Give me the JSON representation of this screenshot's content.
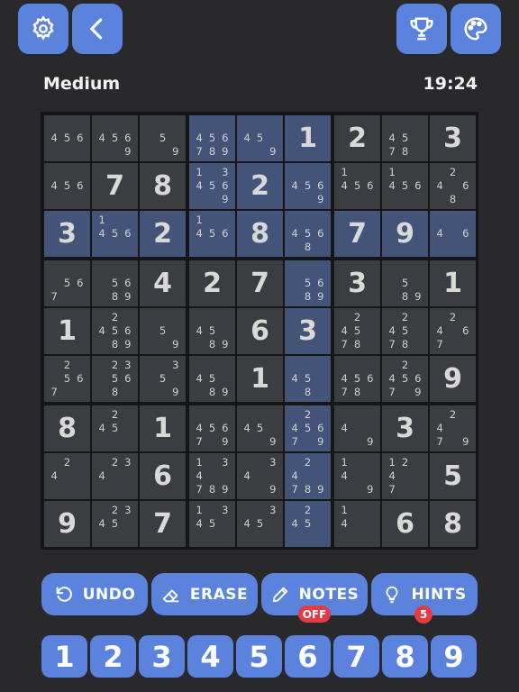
{
  "header": {
    "settings_icon": "gear-icon",
    "back_icon": "chevron-left-icon",
    "trophy_icon": "trophy-icon",
    "palette_icon": "palette-icon",
    "difficulty": "Medium",
    "timer": "19:24"
  },
  "board": {
    "selected": [
      2,
      5
    ],
    "cells": [
      [
        {
          "n": [
            4,
            5,
            6
          ]
        },
        {
          "n": [
            4,
            5,
            6,
            9
          ]
        },
        {
          "n": [
            5,
            9
          ]
        },
        {
          "n": [
            4,
            5,
            6,
            7,
            8,
            9
          ]
        },
        {
          "n": [
            4,
            5,
            9
          ]
        },
        {
          "v": "1"
        },
        {
          "v": "2"
        },
        {
          "n": [
            4,
            5,
            7,
            8
          ]
        },
        {
          "v": "3"
        }
      ],
      [
        {
          "n": [
            4,
            5,
            6
          ]
        },
        {
          "v": "7"
        },
        {
          "v": "8"
        },
        {
          "n": [
            1,
            3,
            4,
            5,
            6,
            9
          ]
        },
        {
          "v": "2"
        },
        {
          "n": [
            4,
            5,
            6,
            9
          ]
        },
        {
          "n": [
            1,
            4,
            5,
            6
          ]
        },
        {
          "n": [
            1,
            4,
            5,
            6
          ]
        },
        {
          "n": [
            2,
            4,
            6,
            8
          ]
        }
      ],
      [
        {
          "v": "3"
        },
        {
          "n": [
            1,
            4,
            5,
            6
          ]
        },
        {
          "v": "2"
        },
        {
          "n": [
            1,
            4,
            5,
            6
          ]
        },
        {
          "v": "8"
        },
        {
          "n": [
            4,
            5,
            6,
            8
          ]
        },
        {
          "v": "7"
        },
        {
          "v": "9"
        },
        {
          "n": [
            4,
            6
          ]
        }
      ],
      [
        {
          "n": [
            5,
            6,
            7
          ]
        },
        {
          "n": [
            5,
            6,
            8,
            9
          ]
        },
        {
          "v": "4"
        },
        {
          "v": "2"
        },
        {
          "v": "7"
        },
        {
          "n": [
            5,
            6,
            8,
            9
          ]
        },
        {
          "v": "3"
        },
        {
          "n": [
            5,
            8,
            9
          ]
        },
        {
          "v": "1"
        }
      ],
      [
        {
          "v": "1"
        },
        {
          "n": [
            2,
            4,
            5,
            6,
            8,
            9
          ]
        },
        {
          "n": [
            5,
            9
          ]
        },
        {
          "n": [
            4,
            5,
            8,
            9
          ]
        },
        {
          "v": "6"
        },
        {
          "v": "3"
        },
        {
          "n": [
            2,
            4,
            5,
            7,
            8
          ]
        },
        {
          "n": [
            2,
            4,
            5,
            7,
            8
          ]
        },
        {
          "n": [
            2,
            4,
            6,
            7
          ]
        }
      ],
      [
        {
          "n": [
            2,
            5,
            6,
            7
          ]
        },
        {
          "n": [
            2,
            3,
            5,
            6,
            8
          ]
        },
        {
          "n": [
            3,
            5,
            9
          ]
        },
        {
          "n": [
            4,
            5,
            8,
            9
          ]
        },
        {
          "v": "1"
        },
        {
          "n": [
            4,
            5,
            8
          ]
        },
        {
          "n": [
            4,
            5,
            6,
            7,
            8
          ]
        },
        {
          "n": [
            2,
            4,
            5,
            6,
            7,
            9
          ]
        },
        {
          "v": "9"
        }
      ],
      [
        {
          "v": "8"
        },
        {
          "n": [
            2,
            4,
            5
          ]
        },
        {
          "v": "1"
        },
        {
          "n": [
            4,
            5,
            6,
            7,
            9
          ]
        },
        {
          "n": [
            4,
            5,
            9
          ]
        },
        {
          "n": [
            2,
            4,
            5,
            6,
            7,
            9
          ]
        },
        {
          "n": [
            4,
            9
          ]
        },
        {
          "v": "3"
        },
        {
          "n": [
            2,
            4,
            7,
            9
          ]
        }
      ],
      [
        {
          "n": [
            2,
            4
          ]
        },
        {
          "n": [
            2,
            3,
            4
          ]
        },
        {
          "v": "6"
        },
        {
          "n": [
            1,
            3,
            4,
            7,
            8,
            9
          ]
        },
        {
          "n": [
            3,
            4,
            9
          ]
        },
        {
          "n": [
            2,
            4,
            7,
            8,
            9
          ]
        },
        {
          "n": [
            1,
            4,
            9
          ]
        },
        {
          "n": [
            1,
            2,
            4,
            7
          ]
        },
        {
          "v": "5"
        }
      ],
      [
        {
          "v": "9"
        },
        {
          "n": [
            2,
            3,
            4,
            5
          ]
        },
        {
          "v": "7"
        },
        {
          "n": [
            1,
            3,
            4,
            5
          ]
        },
        {
          "n": [
            3,
            4,
            5
          ]
        },
        {
          "n": [
            2,
            4,
            5
          ]
        },
        {
          "n": [
            1,
            4
          ]
        },
        {
          "v": "6"
        },
        {
          "v": "8"
        }
      ]
    ]
  },
  "actions": {
    "undo": {
      "label": "UNDO",
      "icon": "undo-icon"
    },
    "erase": {
      "label": "ERASE",
      "icon": "eraser-icon"
    },
    "notes": {
      "label": "NOTES",
      "icon": "pencil-icon",
      "badge": "OFF"
    },
    "hints": {
      "label": "HINTS",
      "icon": "lightbulb-icon",
      "badge": "5"
    }
  },
  "numpad": [
    "1",
    "2",
    "3",
    "4",
    "5",
    "6",
    "7",
    "8",
    "9"
  ],
  "colors": {
    "accent": "#5b82dd",
    "background": "#29292c",
    "cell": "#3b3d42",
    "highlight": "#445478",
    "badge": "#e43b43"
  }
}
